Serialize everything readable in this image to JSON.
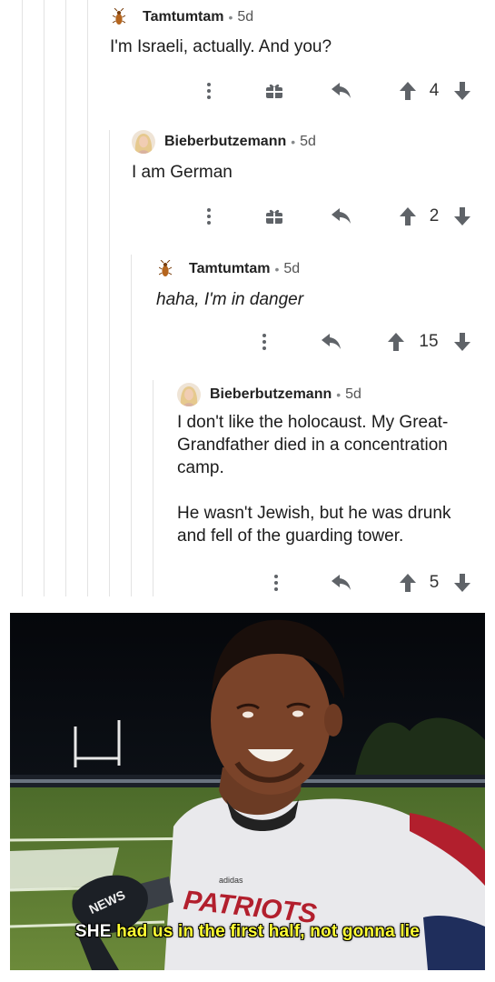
{
  "comments": [
    {
      "user": "Tamtumtam",
      "age": "5d",
      "body": "I'm Israeli, actually. And you?",
      "score": "4",
      "avatar": "cockroach-icon"
    },
    {
      "user": "Bieberbutzemann",
      "age": "5d",
      "body": "I am German",
      "score": "2",
      "avatar": "woman-avatar"
    },
    {
      "user": "Tamtumtam",
      "age": "5d",
      "body": "haha, I'm in danger",
      "score": "15",
      "avatar": "cockroach-icon"
    },
    {
      "user": "Bieberbutzemann",
      "age": "5d",
      "body_paragraphs": [
        "I don't like the holocaust. My Great-Grandfather died in a concentration camp.",
        "He wasn't Jewish, but he was drunk and fell of the guarding tower."
      ],
      "score": "5",
      "avatar": "woman-avatar"
    }
  ],
  "separator": "•",
  "icons": {
    "more": "more-options-icon",
    "award": "gift-award-icon",
    "reply": "reply-arrow-icon",
    "upvote": "upvote-arrow-icon",
    "downvote": "downvote-arrow-icon"
  },
  "meme": {
    "caption_first_word": "SHE",
    "caption_rest": "had us in the first half, not gonna lie",
    "jersey_text": "PATRIOTS",
    "mic_text": "NEWS",
    "brand_text": "adidas"
  },
  "colors": {
    "caption": "#ffff33",
    "icon": "#5f6368",
    "thread_line": "#e3e3e3"
  }
}
